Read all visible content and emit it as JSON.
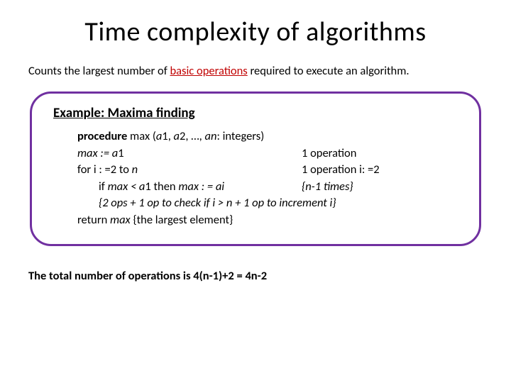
{
  "title": "Time complexity of algorithms",
  "subtitle_pre": "Counts the largest number of ",
  "subtitle_hl": "basic operations",
  "subtitle_post": " required to execute an algorithm.",
  "box": {
    "heading": "Example: Maxima finding",
    "lines": {
      "l1_a": "procedure",
      "l1_b": " max (",
      "l1_c": "a",
      "l1_d": "1, ",
      "l1_e": "a",
      "l1_f": "2, …, ",
      "l1_g": "an",
      "l1_h": ": integers)",
      "l2_left": "max := a",
      "l2_left2": "1",
      "l2_right": "1 operation",
      "l3_left_a": "for i : =2 to ",
      "l3_left_b": "n",
      "l3_right": "1 operation i: =2",
      "l4_left_a": "if ",
      "l4_left_b": "max < a",
      "l4_left_c": "1 then ",
      "l4_left_d": "max : = ai",
      "l4_right": "{n-1 times}",
      "l5": "{2 ops + 1 op to check if i > n + 1 op to increment i}",
      "l6_a": "return ",
      "l6_b": "max ",
      "l6_c": "{the largest element}"
    }
  },
  "conclusion": "The total number of operations is 4(n-1)+2 = 4n-2"
}
